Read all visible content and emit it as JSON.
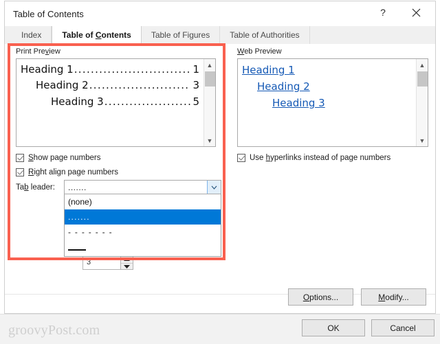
{
  "window": {
    "title": "Table of Contents",
    "help_icon": "question-mark-icon",
    "help_label": "?",
    "close_icon": "close-icon"
  },
  "tabs": [
    {
      "label": "Index",
      "accel": "",
      "active": false
    },
    {
      "label": "Table of Contents",
      "accel": "C",
      "active": true
    },
    {
      "label": "Table of Figures",
      "accel": "",
      "active": false
    },
    {
      "label": "Table of Authorities",
      "accel": "",
      "active": false
    }
  ],
  "print_preview": {
    "group_label_pre": "Print Pre",
    "group_label_accel": "v",
    "group_label_post": "iew",
    "entries": [
      {
        "text": "Heading 1",
        "leader": "......................................",
        "page": "1",
        "level": 1
      },
      {
        "text": "Heading 2",
        "leader": "................................",
        "page": "3",
        "level": 2
      },
      {
        "text": "Heading 3",
        "leader": "..........................",
        "page": "5",
        "level": 3
      }
    ],
    "scrollbar": {
      "up": "▲",
      "down": "▼"
    }
  },
  "web_preview": {
    "group_label_accel": "W",
    "group_label_post": "eb Preview",
    "entries": [
      {
        "text": "Heading 1",
        "level": 1
      },
      {
        "text": "Heading 2",
        "level": 2
      },
      {
        "text": "Heading 3",
        "level": 3
      }
    ],
    "scrollbar": {
      "up": "▲",
      "down": "▼"
    },
    "link_color": "#1559b5"
  },
  "options": {
    "show_page_numbers": {
      "pre": "",
      "accel": "S",
      "post": "how page numbers",
      "checked": true
    },
    "right_align_page_numbers": {
      "pre": "",
      "accel": "R",
      "post": "ight align page numbers",
      "checked": true
    },
    "use_hyperlinks": {
      "pre": "Use ",
      "accel": "h",
      "post": "yperlinks instead of page numbers",
      "checked": true
    }
  },
  "tab_leader": {
    "label_pre": "Ta",
    "label_accel": "b",
    "label_post": " leader:",
    "value": ".......",
    "arrow_icon": "chevron-down-icon",
    "open": true,
    "items": [
      {
        "label": "(none)",
        "kind": "text",
        "selected": false
      },
      {
        "label": ".......",
        "kind": "dots",
        "selected": true
      },
      {
        "label": "- - - - - - -",
        "kind": "dashes",
        "selected": false
      },
      {
        "label": "",
        "kind": "solid",
        "selected": false
      }
    ]
  },
  "spinner": {
    "value": "3",
    "up_icon": "spinner-up-icon",
    "down_icon": "spinner-down-icon"
  },
  "buttons": {
    "options": {
      "pre": "",
      "accel": "O",
      "post": "ptions..."
    },
    "modify": {
      "pre": "",
      "accel": "M",
      "post": "odify..."
    },
    "ok": "OK",
    "cancel": "Cancel"
  },
  "annotation": {
    "highlight_color": "#f9604f"
  },
  "watermark": "groovyPost.com"
}
